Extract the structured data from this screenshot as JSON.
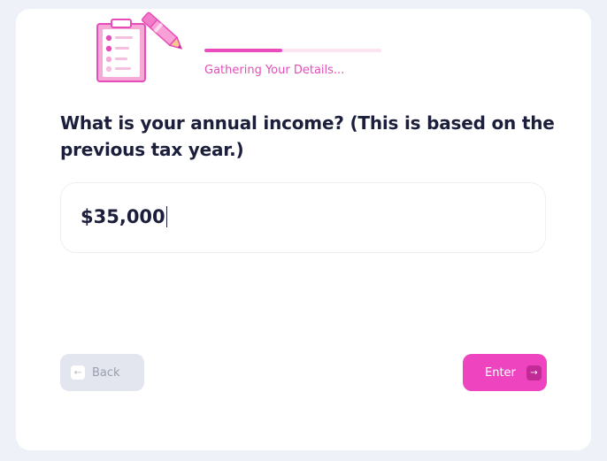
{
  "progress": {
    "label": "Gathering Your Details...",
    "fraction": 0.44
  },
  "question": {
    "text": "What is your annual income? (This is based on the previous tax year.)"
  },
  "income_input": {
    "value": "$35,000"
  },
  "buttons": {
    "back_label": "Back",
    "back_icon": "arrow-left-icon",
    "enter_label": "Enter",
    "enter_icon": "arrow-right-icon"
  },
  "illustration": {
    "icon": "clipboard-pencil-icon"
  },
  "colors": {
    "accent": "#ef44c0",
    "progress_track": "#fce4f1",
    "text_dark": "#1b1f3b",
    "background": "#eef1f7"
  }
}
